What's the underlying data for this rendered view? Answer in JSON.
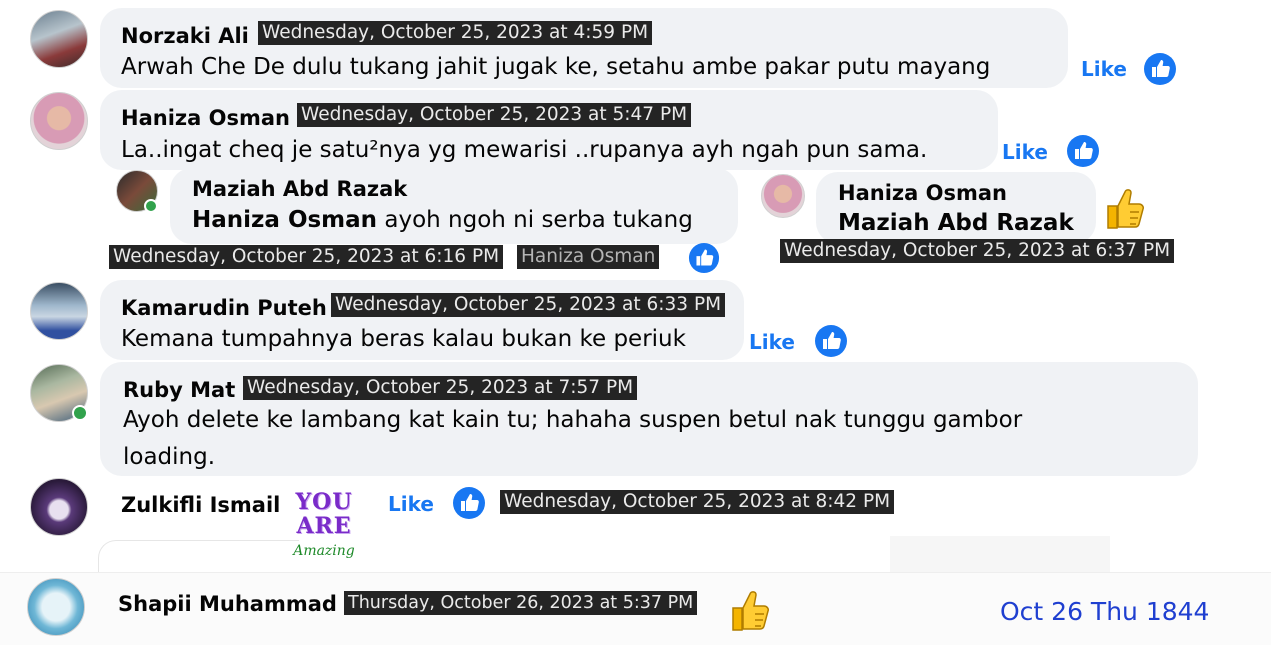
{
  "like_label": "Like",
  "colors": {
    "accent": "#1877f2",
    "bubble": "#f0f2f5",
    "tag_bg": "#242424",
    "online": "#31a24c"
  },
  "comments": [
    {
      "name": "Norzaki Ali",
      "time": "Wednesday, October 25, 2023 at 4:59 PM",
      "text": "Arwah Che De dulu tukang jahit jugak ke, setahu ambe pakar putu mayang"
    },
    {
      "name": "Haniza Osman",
      "time": "Wednesday, October 25, 2023 at 5:47 PM",
      "text": "La..ingat cheq je satu²nya yg mewarisi ..rupanya ayh ngah pun sama."
    },
    {
      "name": "Maziah Abd Razak",
      "time": "Wednesday, October 25, 2023 at 6:16 PM",
      "mention": "Haniza Osman",
      "text": " ayoh ngoh ni serba tukang",
      "reply_mention": "Haniza Osman"
    },
    {
      "name": "Haniza Osman",
      "time": "Wednesday, October 25, 2023 at 6:37 PM",
      "mention": "Maziah Abd Razak"
    },
    {
      "name": "Kamarudin Puteh",
      "time": "Wednesday, October 25, 2023 at 6:33 PM",
      "text": "Kemana tumpahnya beras kalau bukan ke periuk"
    },
    {
      "name": "Ruby Mat",
      "time": "Wednesday, October 25, 2023 at 7:57 PM",
      "text_line1": "Ayoh delete ke lambang kat kain tu; hahaha suspen betul nak tunggu gambor",
      "text_line2": "loading."
    },
    {
      "name": "Zulkifli Ismail",
      "time": "Wednesday, October 25, 2023 at 8:42 PM",
      "sticker_line1": "YOU",
      "sticker_line2": "ARE",
      "sticker_line3": "Amazing"
    },
    {
      "name": "Shapii Muhammad",
      "time": "Thursday, October 26, 2023 at 5:37 PM"
    }
  ],
  "stamp": "Oct 26 Thu 1844",
  "icons": [
    "like-reaction-icon",
    "thumbs-up-emoji-icon",
    "avatar-icon"
  ]
}
